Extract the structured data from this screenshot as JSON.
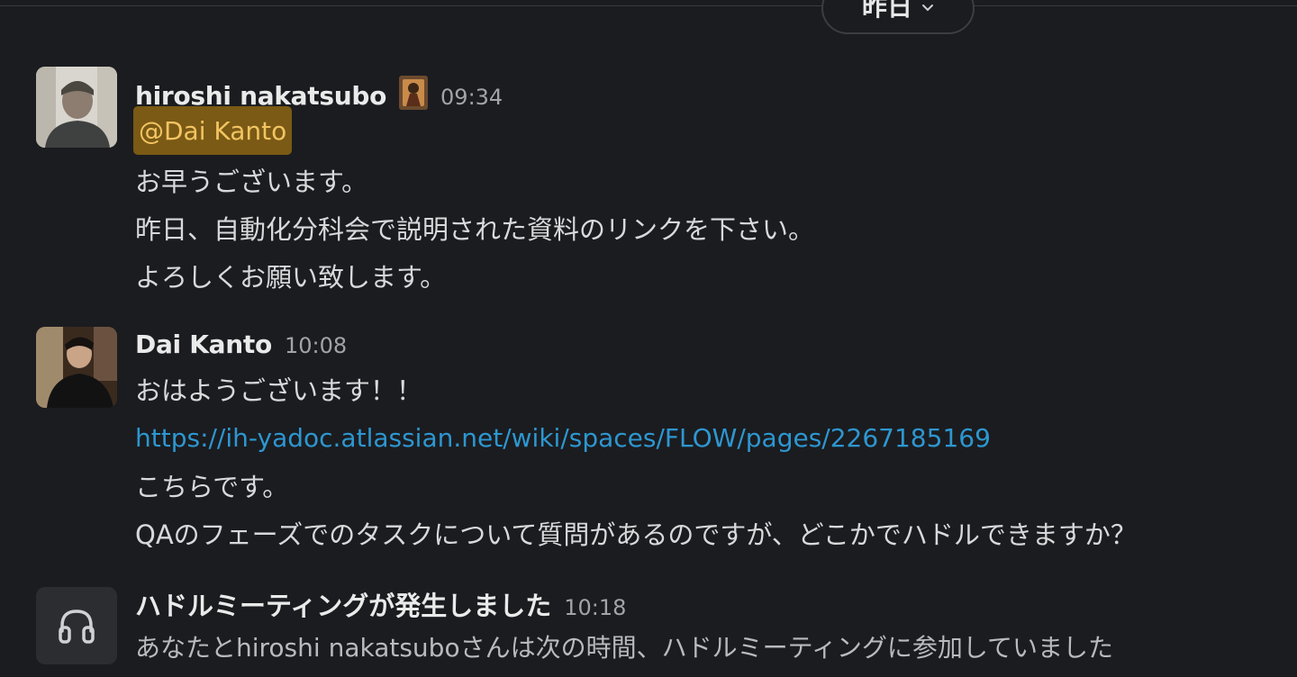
{
  "date_divider": {
    "label": "昨日"
  },
  "messages": [
    {
      "sender": "hiroshi nakatsubo",
      "time": "09:34",
      "mention": "@Dai Kanto",
      "lines": [
        "お早うございます。",
        "昨日、自動化分科会で説明された資料のリンクを下さい。",
        "よろしくお願い致します。"
      ]
    },
    {
      "sender": "Dai Kanto",
      "time": "10:08",
      "lines": [
        "おはようございます！！",
        "https://ih-yadoc.atlassian.net/wiki/spaces/FLOW/pages/2267185169",
        "こちらです。",
        "QAのフェーズでのタスクについて質問があるのですが、どこかでハドルできますか？"
      ]
    }
  ],
  "huddle": {
    "title": "ハドルミーティングが発生しました",
    "time": "10:18",
    "text": "あなたとhiroshi nakatsuboさんは次の時間、ハドルミーティングに参加していました"
  },
  "icons": {
    "date_chevron": "chevron-down-icon",
    "huddle": "headphones-icon",
    "status": "status-emoji-icon"
  },
  "colors": {
    "background": "#1b1c20",
    "mention_bg": "#7a5a14",
    "mention_text": "#f3c463",
    "link": "#2d97d0"
  }
}
